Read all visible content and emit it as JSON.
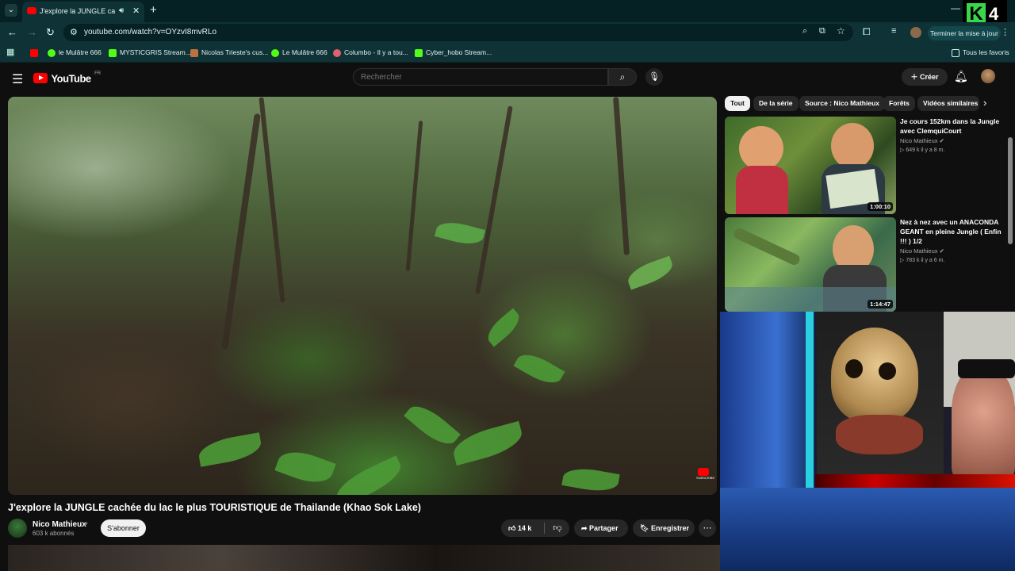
{
  "browser": {
    "tab_title": "J'explore la JUNGLE cachée du lac le plus TOURISTIQUE de Thailande (Khao Sok Lake) - YouTube",
    "url": "youtube.com/watch?v=OYzvI8mvRLo",
    "update_button": "Terminer la mise à jour",
    "bookmarks": [
      {
        "label": "",
        "color": "#ff0000"
      },
      {
        "label": "le Mulâtre 666",
        "color": "#53fc18"
      },
      {
        "label": "MYSTICGRIS Stream...",
        "color": "#53fc18"
      },
      {
        "label": "Nicolas Trieste's cus...",
        "color": "#c07040"
      },
      {
        "label": "Le Mulâtre 666",
        "color": "#53fc18"
      },
      {
        "label": "Columbo - Il y a tou...",
        "color": "#e06070"
      },
      {
        "label": "Cyber_hobo Stream...",
        "color": "#53fc18"
      }
    ],
    "all_bookmarks": "Tous les favoris",
    "overlay_logo": {
      "letter": "K",
      "number": "4"
    }
  },
  "youtube": {
    "logo_text": "YouTube",
    "country_code": "FR",
    "search_placeholder": "Rechercher",
    "create_label": "Créer",
    "video": {
      "title": "J'explore la JUNGLE cachée du lac le plus TOURISTIQUE de Thailande (Khao Sok Lake)",
      "channel": "Nico Mathieux",
      "subscribers": "603 k abonnés",
      "subscribe_label": "S'abonner",
      "likes": "14 k",
      "share_label": "Partager",
      "save_label": "Enregistrer",
      "badge_text": "SUBSCRIBE"
    },
    "chips": [
      {
        "label": "Tout",
        "active": true
      },
      {
        "label": "De la série",
        "active": false
      },
      {
        "label": "Source : Nico Mathieux",
        "active": false
      },
      {
        "label": "Forêts",
        "active": false
      },
      {
        "label": "Vidéos similaires",
        "active": false
      }
    ],
    "recommendations": [
      {
        "title": "Je cours 152km dans la Jungle avec ClemquiCourt",
        "channel": "Nico Mathieux",
        "meta": "649 k  il y a 8 m.",
        "duration": "1:00:10"
      },
      {
        "title": "Nez à nez avec un ANACONDA GEANT en pleine Jungle ( Enfin !!! ) 1/2",
        "channel": "Nico Mathieux",
        "meta": "783 k  il y a 6 m.",
        "duration": "1:14:47"
      }
    ]
  }
}
